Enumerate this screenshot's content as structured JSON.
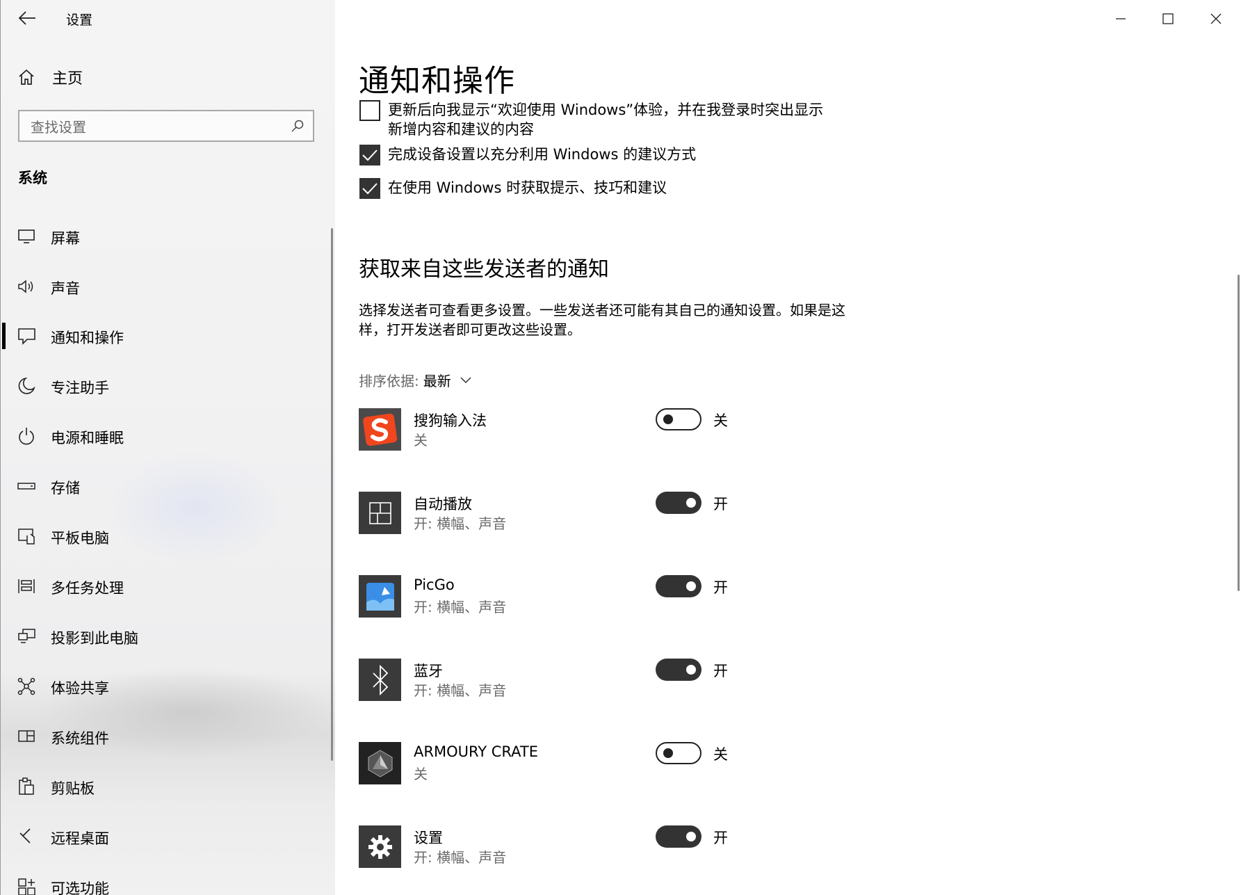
{
  "window": {
    "title": "设置",
    "minimize": "minimize-icon",
    "maximize": "maximize-icon",
    "close": "close-icon"
  },
  "sidebar": {
    "home_label": "主页",
    "search_placeholder": "查找设置",
    "section_title": "系统",
    "items": [
      {
        "label": "屏幕",
        "icon": "display-icon"
      },
      {
        "label": "声音",
        "icon": "speaker-icon"
      },
      {
        "label": "通知和操作",
        "icon": "notification-icon",
        "selected": true
      },
      {
        "label": "专注助手",
        "icon": "moon-icon"
      },
      {
        "label": "电源和睡眠",
        "icon": "power-icon"
      },
      {
        "label": "存储",
        "icon": "storage-icon"
      },
      {
        "label": "平板电脑",
        "icon": "tablet-icon"
      },
      {
        "label": "多任务处理",
        "icon": "multitasking-icon"
      },
      {
        "label": "投影到此电脑",
        "icon": "projection-icon"
      },
      {
        "label": "体验共享",
        "icon": "share-icon"
      },
      {
        "label": "系统组件",
        "icon": "components-icon"
      },
      {
        "label": "剪贴板",
        "icon": "clipboard-icon"
      },
      {
        "label": "远程桌面",
        "icon": "remote-desktop-icon"
      },
      {
        "label": "可选功能",
        "icon": "optional-features-icon"
      }
    ]
  },
  "main": {
    "title": "通知和操作",
    "checkboxes": [
      {
        "label_line1": "更新后向我显示“欢迎使用 Windows”体验，并在我登录时突出显示",
        "label_line2": "新增内容和建议的内容",
        "checked": false
      },
      {
        "label_line1": "完成设备设置以充分利用 Windows 的建议方式",
        "checked": true
      },
      {
        "label_line1": "在使用 Windows 时获取提示、技巧和建议",
        "checked": true
      }
    ],
    "senders_heading": "获取来自这些发送者的通知",
    "senders_desc": "选择发送者可查看更多设置。一些发送者还可能有其自己的通知设置。如果是这样，打开发送者即可更改这些设置。",
    "sort_label": "排序依据:",
    "sort_value": "最新",
    "senders": [
      {
        "name": "搜狗输入法",
        "status": "关",
        "toggle_on": false,
        "toggle_label": "关",
        "icon": "sogou-icon"
      },
      {
        "name": "自动播放",
        "status": "开: 横幅、声音",
        "toggle_on": true,
        "toggle_label": "开",
        "icon": "autoplay-icon"
      },
      {
        "name": "PicGo",
        "status": "开: 横幅、声音",
        "toggle_on": true,
        "toggle_label": "开",
        "icon": "picgo-icon"
      },
      {
        "name": "蓝牙",
        "status": "开: 横幅、声音",
        "toggle_on": true,
        "toggle_label": "开",
        "icon": "bluetooth-icon"
      },
      {
        "name": "ARMOURY CRATE",
        "status": "关",
        "toggle_on": false,
        "toggle_label": "关",
        "icon": "armoury-crate-icon"
      },
      {
        "name": "设置",
        "status": "开: 横幅、声音",
        "toggle_on": true,
        "toggle_label": "开",
        "icon": "settings-gear-icon"
      }
    ]
  }
}
